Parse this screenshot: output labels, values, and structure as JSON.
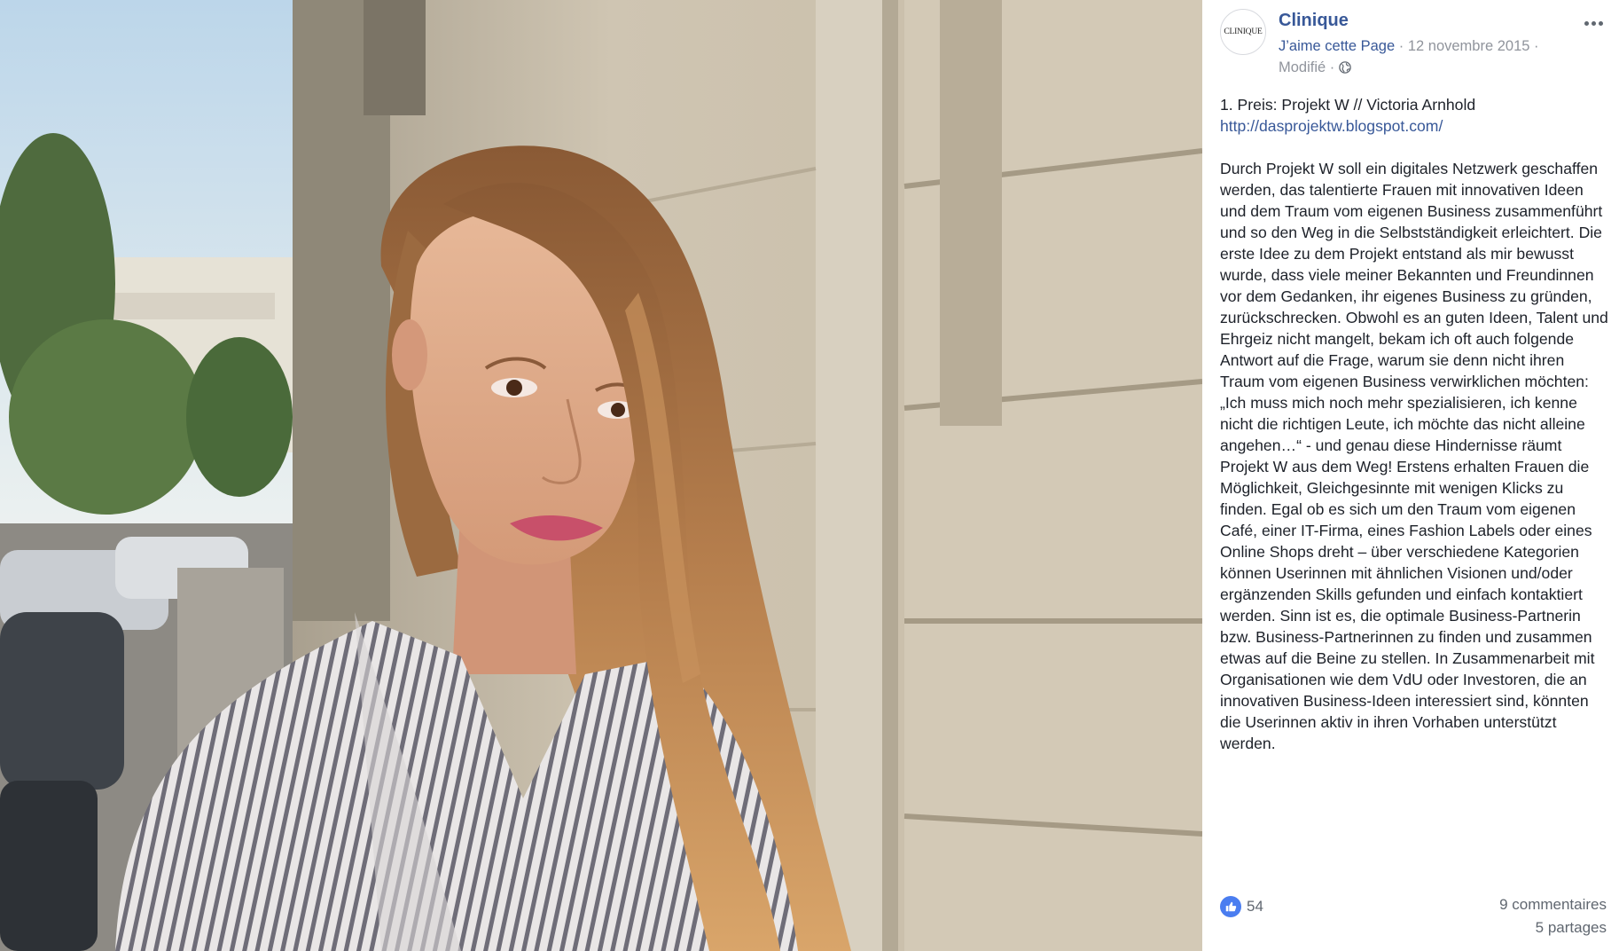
{
  "page": {
    "avatar_text": "CLINIQUE",
    "name": "Clinique",
    "like_page": "J’aime cette Page",
    "separator": " · ",
    "date": "12 novembre 2015",
    "edited": "Modifié"
  },
  "icons": {
    "more": "more-options-icon",
    "privacy": "globe-icon",
    "reaction": "like-thumb-icon"
  },
  "post": {
    "heading": "1. Preis: Projekt W // Victoria Arnhold",
    "link": "http://dasprojektw.blogspot.com/",
    "body": "Durch Projekt W soll ein digitales Netzwerk geschaffen werden, das talentierte Frauen mit innovativen Ideen und dem Traum vom eigenen Business zusammenführt und so den Weg in die Selbstständigkeit erleichtert. Die erste Idee zu dem Projekt entstand als mir bewusst wurde, dass viele meiner Bekannten und Freundinnen vor dem Gedanken, ihr eigenes Business zu gründen, zurückschrecken. Obwohl es an guten Ideen, Talent und Ehrgeiz nicht mangelt, bekam ich oft auch folgende Antwort auf die Frage, warum sie denn nicht ihren Traum vom eigenen Business verwirklichen möchten: „Ich muss mich noch mehr spezialisieren, ich kenne nicht die richtigen Leute, ich möchte das nicht alleine angehen…“ - und genau diese Hindernisse räumt Projekt W aus dem Weg! Erstens erhalten Frauen die Möglichkeit, Gleichgesinnte mit wenigen Klicks zu finden. Egal ob es sich um den Traum vom eigenen Café, einer IT-Firma, eines Fashion Labels oder eines Online Shops dreht – über verschiedene Kategorien können Userinnen mit ähnlichen Visionen und/oder ergänzenden Skills gefunden und einfach kontaktiert werden. Sinn ist es, die optimale Business-Partnerin bzw. Business-Partnerinnen zu finden und zusammen etwas auf die Beine zu stellen. In Zusammenarbeit mit Organisationen wie dem VdU oder Investoren, die an innovativen Business-Ideen interessiert sind, könnten die Userinnen aktiv in ihren Vorhaben unterstützt werden."
  },
  "stats": {
    "reactions": "54",
    "comments": "9 commentaires",
    "shares": "5 partages"
  },
  "colors": {
    "link": "#385898",
    "like_blue": "#4a7df0",
    "muted": "#90949c",
    "text": "#1d2129"
  }
}
